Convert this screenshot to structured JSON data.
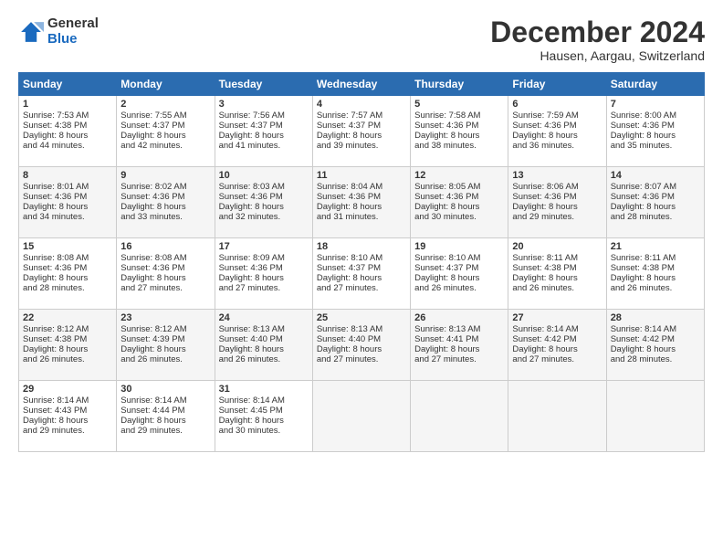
{
  "logo": {
    "general": "General",
    "blue": "Blue"
  },
  "title": "December 2024",
  "subtitle": "Hausen, Aargau, Switzerland",
  "headers": [
    "Sunday",
    "Monday",
    "Tuesday",
    "Wednesday",
    "Thursday",
    "Friday",
    "Saturday"
  ],
  "weeks": [
    [
      {
        "day": "1",
        "lines": [
          "Sunrise: 7:53 AM",
          "Sunset: 4:38 PM",
          "Daylight: 8 hours",
          "and 44 minutes."
        ]
      },
      {
        "day": "2",
        "lines": [
          "Sunrise: 7:55 AM",
          "Sunset: 4:37 PM",
          "Daylight: 8 hours",
          "and 42 minutes."
        ]
      },
      {
        "day": "3",
        "lines": [
          "Sunrise: 7:56 AM",
          "Sunset: 4:37 PM",
          "Daylight: 8 hours",
          "and 41 minutes."
        ]
      },
      {
        "day": "4",
        "lines": [
          "Sunrise: 7:57 AM",
          "Sunset: 4:37 PM",
          "Daylight: 8 hours",
          "and 39 minutes."
        ]
      },
      {
        "day": "5",
        "lines": [
          "Sunrise: 7:58 AM",
          "Sunset: 4:36 PM",
          "Daylight: 8 hours",
          "and 38 minutes."
        ]
      },
      {
        "day": "6",
        "lines": [
          "Sunrise: 7:59 AM",
          "Sunset: 4:36 PM",
          "Daylight: 8 hours",
          "and 36 minutes."
        ]
      },
      {
        "day": "7",
        "lines": [
          "Sunrise: 8:00 AM",
          "Sunset: 4:36 PM",
          "Daylight: 8 hours",
          "and 35 minutes."
        ]
      }
    ],
    [
      {
        "day": "8",
        "lines": [
          "Sunrise: 8:01 AM",
          "Sunset: 4:36 PM",
          "Daylight: 8 hours",
          "and 34 minutes."
        ]
      },
      {
        "day": "9",
        "lines": [
          "Sunrise: 8:02 AM",
          "Sunset: 4:36 PM",
          "Daylight: 8 hours",
          "and 33 minutes."
        ]
      },
      {
        "day": "10",
        "lines": [
          "Sunrise: 8:03 AM",
          "Sunset: 4:36 PM",
          "Daylight: 8 hours",
          "and 32 minutes."
        ]
      },
      {
        "day": "11",
        "lines": [
          "Sunrise: 8:04 AM",
          "Sunset: 4:36 PM",
          "Daylight: 8 hours",
          "and 31 minutes."
        ]
      },
      {
        "day": "12",
        "lines": [
          "Sunrise: 8:05 AM",
          "Sunset: 4:36 PM",
          "Daylight: 8 hours",
          "and 30 minutes."
        ]
      },
      {
        "day": "13",
        "lines": [
          "Sunrise: 8:06 AM",
          "Sunset: 4:36 PM",
          "Daylight: 8 hours",
          "and 29 minutes."
        ]
      },
      {
        "day": "14",
        "lines": [
          "Sunrise: 8:07 AM",
          "Sunset: 4:36 PM",
          "Daylight: 8 hours",
          "and 28 minutes."
        ]
      }
    ],
    [
      {
        "day": "15",
        "lines": [
          "Sunrise: 8:08 AM",
          "Sunset: 4:36 PM",
          "Daylight: 8 hours",
          "and 28 minutes."
        ]
      },
      {
        "day": "16",
        "lines": [
          "Sunrise: 8:08 AM",
          "Sunset: 4:36 PM",
          "Daylight: 8 hours",
          "and 27 minutes."
        ]
      },
      {
        "day": "17",
        "lines": [
          "Sunrise: 8:09 AM",
          "Sunset: 4:36 PM",
          "Daylight: 8 hours",
          "and 27 minutes."
        ]
      },
      {
        "day": "18",
        "lines": [
          "Sunrise: 8:10 AM",
          "Sunset: 4:37 PM",
          "Daylight: 8 hours",
          "and 27 minutes."
        ]
      },
      {
        "day": "19",
        "lines": [
          "Sunrise: 8:10 AM",
          "Sunset: 4:37 PM",
          "Daylight: 8 hours",
          "and 26 minutes."
        ]
      },
      {
        "day": "20",
        "lines": [
          "Sunrise: 8:11 AM",
          "Sunset: 4:38 PM",
          "Daylight: 8 hours",
          "and 26 minutes."
        ]
      },
      {
        "day": "21",
        "lines": [
          "Sunrise: 8:11 AM",
          "Sunset: 4:38 PM",
          "Daylight: 8 hours",
          "and 26 minutes."
        ]
      }
    ],
    [
      {
        "day": "22",
        "lines": [
          "Sunrise: 8:12 AM",
          "Sunset: 4:38 PM",
          "Daylight: 8 hours",
          "and 26 minutes."
        ]
      },
      {
        "day": "23",
        "lines": [
          "Sunrise: 8:12 AM",
          "Sunset: 4:39 PM",
          "Daylight: 8 hours",
          "and 26 minutes."
        ]
      },
      {
        "day": "24",
        "lines": [
          "Sunrise: 8:13 AM",
          "Sunset: 4:40 PM",
          "Daylight: 8 hours",
          "and 26 minutes."
        ]
      },
      {
        "day": "25",
        "lines": [
          "Sunrise: 8:13 AM",
          "Sunset: 4:40 PM",
          "Daylight: 8 hours",
          "and 27 minutes."
        ]
      },
      {
        "day": "26",
        "lines": [
          "Sunrise: 8:13 AM",
          "Sunset: 4:41 PM",
          "Daylight: 8 hours",
          "and 27 minutes."
        ]
      },
      {
        "day": "27",
        "lines": [
          "Sunrise: 8:14 AM",
          "Sunset: 4:42 PM",
          "Daylight: 8 hours",
          "and 27 minutes."
        ]
      },
      {
        "day": "28",
        "lines": [
          "Sunrise: 8:14 AM",
          "Sunset: 4:42 PM",
          "Daylight: 8 hours",
          "and 28 minutes."
        ]
      }
    ],
    [
      {
        "day": "29",
        "lines": [
          "Sunrise: 8:14 AM",
          "Sunset: 4:43 PM",
          "Daylight: 8 hours",
          "and 29 minutes."
        ]
      },
      {
        "day": "30",
        "lines": [
          "Sunrise: 8:14 AM",
          "Sunset: 4:44 PM",
          "Daylight: 8 hours",
          "and 29 minutes."
        ]
      },
      {
        "day": "31",
        "lines": [
          "Sunrise: 8:14 AM",
          "Sunset: 4:45 PM",
          "Daylight: 8 hours",
          "and 30 minutes."
        ]
      },
      null,
      null,
      null,
      null
    ]
  ]
}
